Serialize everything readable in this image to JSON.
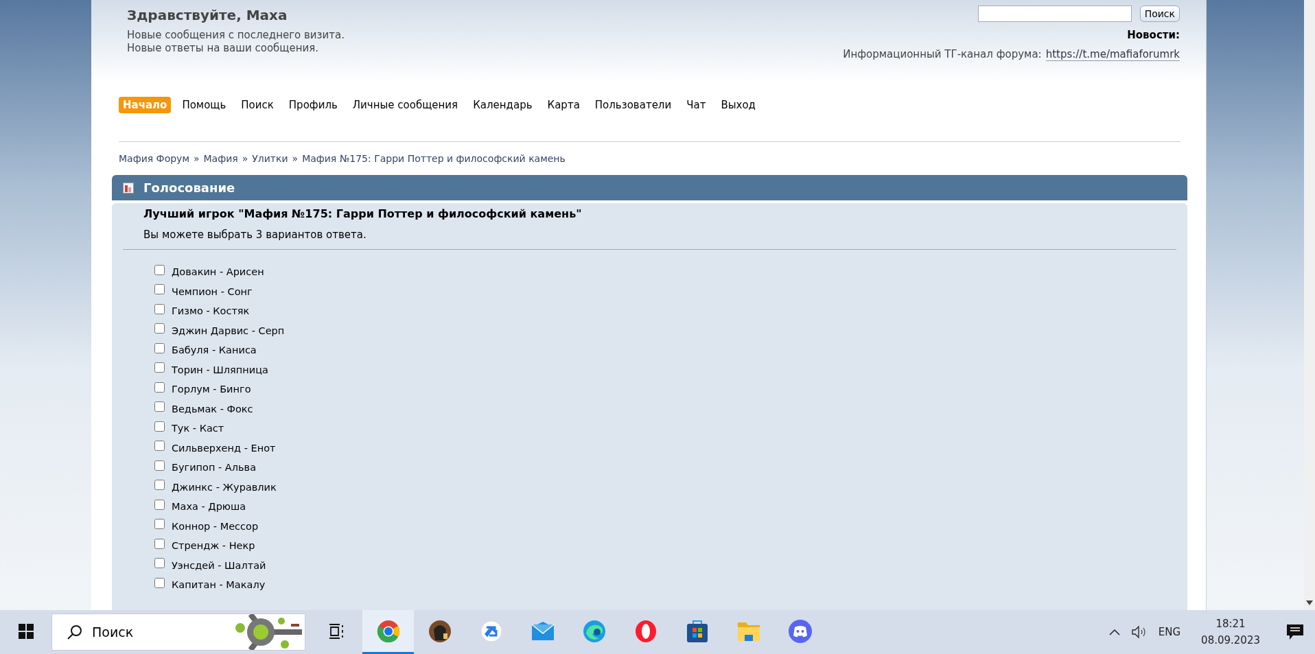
{
  "header": {
    "greeting": "Здравствуйте, Маха",
    "links": [
      "Новые сообщения с последнего визита.",
      "Новые ответы на ваши сообщения."
    ],
    "search": {
      "button": "Поиск"
    },
    "news": {
      "title": "Новости:",
      "text": "Информационный ТГ-канал форума:",
      "link": "https://t.me/mafiaforumrk"
    }
  },
  "nav": [
    {
      "label": "Начало",
      "selected": true
    },
    {
      "label": "Помощь",
      "selected": false
    },
    {
      "label": "Поиск",
      "selected": false
    },
    {
      "label": "Профиль",
      "selected": false
    },
    {
      "label": "Личные сообщения",
      "selected": false
    },
    {
      "label": "Календарь",
      "selected": false
    },
    {
      "label": "Карта",
      "selected": false
    },
    {
      "label": "Пользователи",
      "selected": false
    },
    {
      "label": "Чат",
      "selected": false
    },
    {
      "label": "Выход",
      "selected": false
    }
  ],
  "breadcrumbs": [
    "Мафия Форум",
    "Мафия",
    "Улитки",
    "Мафия №175: Гарри Поттер и философский камень"
  ],
  "breadcrumb_separator": "»",
  "poll": {
    "title": "Голосование",
    "question": "Лучший игрок \"Мафия №175: Гарри Поттер и философский камень\"",
    "hint": "Вы можете выбрать 3 вариантов ответа.",
    "options": [
      {
        "label": "Довакин - Арисен",
        "checked": false
      },
      {
        "label": "Чемпион - Сонг",
        "checked": false
      },
      {
        "label": "Гизмо - Костяк",
        "checked": false
      },
      {
        "label": "Эджин Дарвис - Серп",
        "checked": false
      },
      {
        "label": "Бабуля - Каниса",
        "checked": false
      },
      {
        "label": "Торин - Шляпница",
        "checked": false
      },
      {
        "label": "Горлум - Бинго",
        "checked": false
      },
      {
        "label": "Ведьмак - Фокс",
        "checked": false
      },
      {
        "label": "Тук - Каст",
        "checked": false
      },
      {
        "label": "Сильверхенд - Енот",
        "checked": false
      },
      {
        "label": "Бугипоп - Альва",
        "checked": false
      },
      {
        "label": "Джинкс - Журавлик",
        "checked": false
      },
      {
        "label": "Маха - Дрюша",
        "checked": false
      },
      {
        "label": "Коннор - Мессор",
        "checked": false
      },
      {
        "label": "Стрендж - Некр",
        "checked": false
      },
      {
        "label": "Уэнсдей - Шалтай",
        "checked": false
      },
      {
        "label": "Капитан - Макалу",
        "checked": false
      }
    ]
  },
  "taskbar": {
    "search_placeholder": "Поиск",
    "apps": [
      {
        "kind": "chrome",
        "selected": true
      },
      {
        "kind": "game",
        "selected": false
      },
      {
        "kind": "app",
        "selected": false
      },
      {
        "kind": "mail",
        "selected": false
      },
      {
        "kind": "edge",
        "selected": false
      },
      {
        "kind": "opera",
        "selected": false
      },
      {
        "kind": "store",
        "selected": false
      },
      {
        "kind": "explorer",
        "selected": false
      },
      {
        "kind": "discord",
        "selected": false
      }
    ],
    "language": "ENG",
    "time": "18:21",
    "date": "08.09.2023"
  }
}
